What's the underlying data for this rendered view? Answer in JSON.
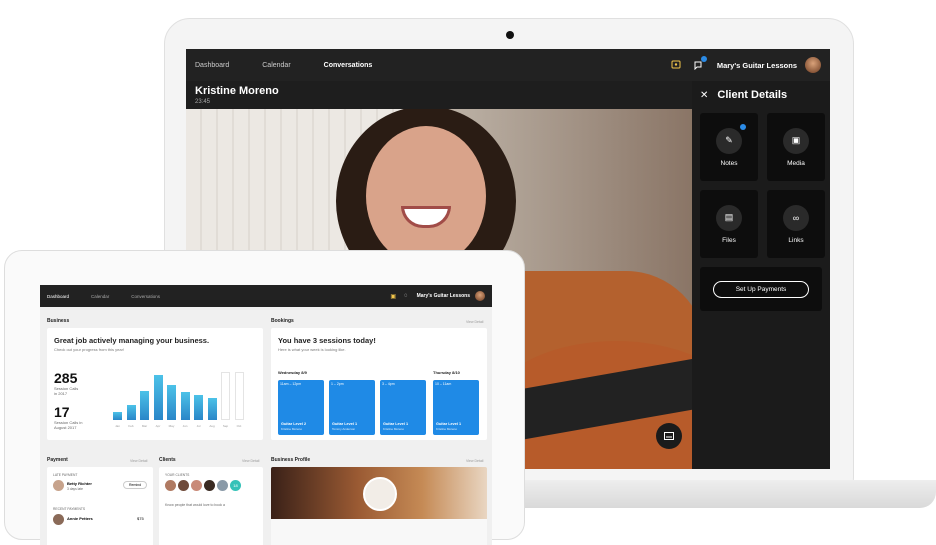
{
  "laptop": {
    "nav": [
      "Dashboard",
      "Calendar",
      "Conversations"
    ],
    "active_nav": "Conversations",
    "brand": "Mary's Guitar Lessons",
    "call": {
      "name": "Kristine Moreno",
      "time": "23:45"
    },
    "panel": {
      "title": "Client Details",
      "tiles": [
        {
          "label": "Notes",
          "icon": "notes-icon",
          "badge": "1"
        },
        {
          "label": "Media",
          "icon": "media-icon"
        },
        {
          "label": "Files",
          "icon": "files-icon"
        },
        {
          "label": "Links",
          "icon": "links-icon"
        }
      ],
      "payments_button": "Set Up Payments"
    }
  },
  "tablet": {
    "nav": [
      "Dashboard",
      "Calendar",
      "Conversations"
    ],
    "brand": "Mary's Guitar Lessons",
    "business": {
      "section": "Business",
      "headline": "Great job actively managing your business.",
      "subhead": "Check out your progress from this year!",
      "stat1": {
        "value": "285",
        "label1": "Session Calls",
        "label2": "in 2017"
      },
      "stat2": {
        "value": "17",
        "label1": "Session Calls in",
        "label2": "August 2017"
      },
      "chart_months": [
        "Jan",
        "Feb",
        "Mar",
        "Apr",
        "May",
        "Jun",
        "Jul",
        "Aug",
        "Sep",
        "Oct"
      ]
    },
    "bookings": {
      "section": "Bookings",
      "view": "View Detail",
      "headline": "You have 3 sessions today!",
      "subhead": "Here is what your week is looking like.",
      "day1": "Wednesday 8/9",
      "day2": "Thursday 8/10",
      "slots": [
        {
          "time": "11am – 12pm",
          "level": "Guitar Level 2",
          "client": "Kristine Moreno"
        },
        {
          "time": "1 – 2pm",
          "level": "Guitar Level 1",
          "client": "Tommy Anderson"
        },
        {
          "time": "3 – 4pm",
          "level": "Guitar Level 1",
          "client": "Kristine Moreno"
        },
        {
          "time": "10 – 11am",
          "level": "Guitar Level 1",
          "client": "Kristine Moreno"
        }
      ]
    },
    "payment": {
      "section": "Payment",
      "view": "View Detail",
      "late_label": "LATE PAYMENT",
      "late_name": "Betty Richter",
      "late_sub": "3 days late",
      "remind": "Remind",
      "recent_label": "RECENT PAYMENTS",
      "recent_name": "Annie Petters",
      "recent_amount": "$75"
    },
    "clients": {
      "section": "Clients",
      "view": "View Detail",
      "label": "YOUR CLIENTS",
      "badge": "18",
      "text": "Know people that would love to book a"
    },
    "profile": {
      "section": "Business Profile",
      "view": "View Detail"
    }
  },
  "chart_data": {
    "type": "bar",
    "categories": [
      "Jan",
      "Feb",
      "Mar",
      "Apr",
      "May",
      "Jun",
      "Jul",
      "Aug",
      "Sep",
      "Oct"
    ],
    "series": [
      {
        "values": [
          10,
          20,
          38,
          58,
          45,
          36,
          32,
          28,
          0,
          0
        ]
      }
    ],
    "ylim": [
      0,
      80
    ]
  }
}
